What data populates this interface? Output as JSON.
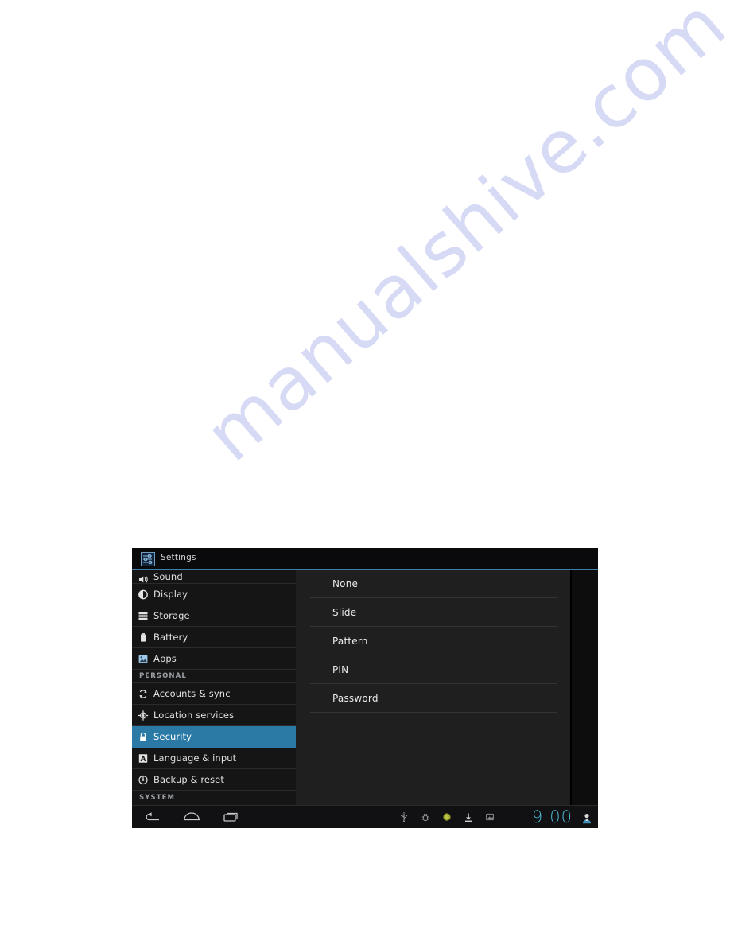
{
  "page": {
    "background_color": "#ffffff",
    "watermark_text": "manualshive.com"
  },
  "device": {
    "titlebar": {
      "app_icon": "settings-sliders-icon",
      "title": "Settings",
      "underline_color": "#3f7fa8"
    },
    "sidebar": {
      "selected_color": "#2b7aa6",
      "items": [
        {
          "label": "Sound",
          "icon": "sound-icon",
          "selected": false,
          "partial": true
        },
        {
          "label": "Display",
          "icon": "display-icon",
          "selected": false
        },
        {
          "label": "Storage",
          "icon": "storage-icon",
          "selected": false
        },
        {
          "label": "Battery",
          "icon": "battery-icon",
          "selected": false
        },
        {
          "label": "Apps",
          "icon": "apps-icon",
          "selected": false
        }
      ],
      "personal_header": "PERSONAL",
      "personal_items": [
        {
          "label": "Accounts & sync",
          "icon": "sync-icon",
          "selected": false
        },
        {
          "label": "Location services",
          "icon": "location-icon",
          "selected": false
        },
        {
          "label": "Security",
          "icon": "lock-icon",
          "selected": true
        },
        {
          "label": "Language & input",
          "icon": "language-a-icon",
          "selected": false
        },
        {
          "label": "Backup & reset",
          "icon": "backup-reset-icon",
          "selected": false
        }
      ],
      "system_header": "SYSTEM"
    },
    "options_panel": {
      "options": [
        {
          "label": "None"
        },
        {
          "label": "Slide"
        },
        {
          "label": "Pattern"
        },
        {
          "label": "PIN"
        },
        {
          "label": "Password"
        }
      ]
    },
    "systembar": {
      "nav": [
        {
          "name": "back-button",
          "icon": "back-arrow-icon"
        },
        {
          "name": "home-button",
          "icon": "home-dome-icon"
        },
        {
          "name": "recents-button",
          "icon": "recent-apps-icon"
        }
      ],
      "status_icons": [
        {
          "name": "usb-icon"
        },
        {
          "name": "adb-debug-icon"
        },
        {
          "name": "notification-dot-icon"
        },
        {
          "name": "download-icon"
        },
        {
          "name": "screenshot-icon"
        }
      ],
      "clock": "9:00",
      "clock_color": "#49b6cf",
      "user_icon": "user-avatar-icon"
    }
  }
}
